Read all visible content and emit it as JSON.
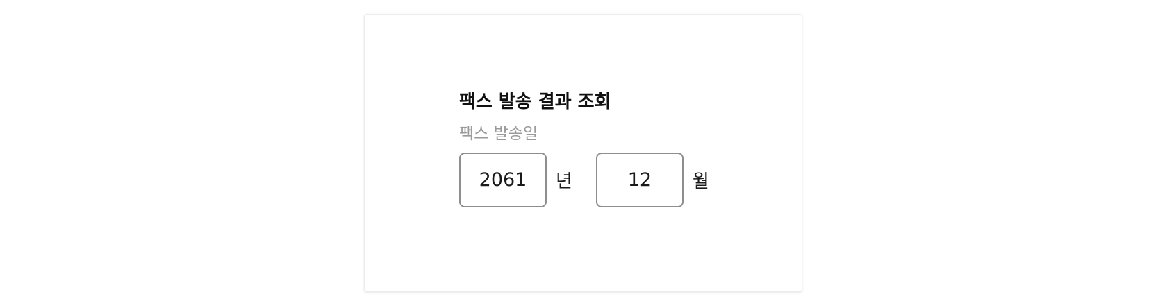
{
  "form": {
    "title": "팩스 발송 결과 조회",
    "date_label": "팩스 발송일",
    "year_value": "2061",
    "year_unit": "년",
    "month_value": "12",
    "month_unit": "월"
  }
}
